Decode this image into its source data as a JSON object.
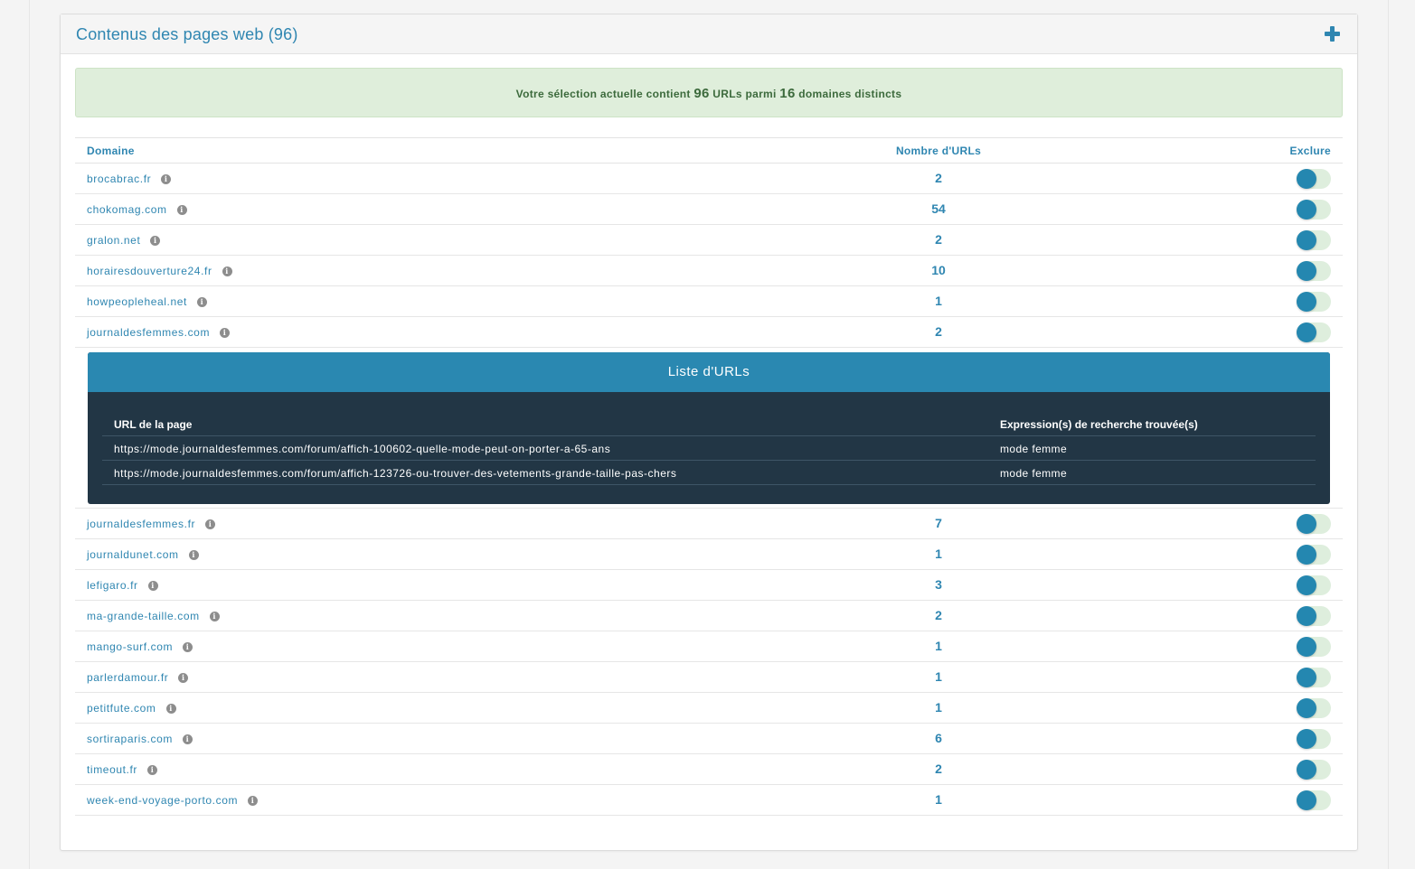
{
  "panel": {
    "title": "Contenus des pages web (96)"
  },
  "alert": {
    "prefix": "Votre sélection actuelle contient",
    "url_count": "96",
    "middle": "URLs parmi",
    "domain_count": "16",
    "suffix": "domaines distincts"
  },
  "table": {
    "headers": {
      "domain": "Domaine",
      "count": "Nombre d'URLs",
      "exclude": "Exclure"
    },
    "rows_before": [
      {
        "domain": "brocabrac.fr",
        "count": "2"
      },
      {
        "domain": "chokomag.com",
        "count": "54"
      },
      {
        "domain": "gralon.net",
        "count": "2"
      },
      {
        "domain": "horairesdouverture24.fr",
        "count": "10"
      },
      {
        "domain": "howpeopleheal.net",
        "count": "1"
      },
      {
        "domain": "journaldesfemmes.com",
        "count": "2"
      }
    ],
    "rows_after": [
      {
        "domain": "journaldesfemmes.fr",
        "count": "7"
      },
      {
        "domain": "journaldunet.com",
        "count": "1"
      },
      {
        "domain": "lefigaro.fr",
        "count": "3"
      },
      {
        "domain": "ma-grande-taille.com",
        "count": "2"
      },
      {
        "domain": "mango-surf.com",
        "count": "1"
      },
      {
        "domain": "parlerdamour.fr",
        "count": "1"
      },
      {
        "domain": "petitfute.com",
        "count": "1"
      },
      {
        "domain": "sortiraparis.com",
        "count": "6"
      },
      {
        "domain": "timeout.fr",
        "count": "2"
      },
      {
        "domain": "week-end-voyage-porto.com",
        "count": "1"
      }
    ]
  },
  "url_list": {
    "title": "Liste d'URLs",
    "headers": {
      "page": "URL de la page",
      "expression": "Expression(s) de recherche trouvée(s)"
    },
    "rows": [
      {
        "url": "https://mode.journaldesfemmes.com/forum/affich-100602-quelle-mode-peut-on-porter-a-65-ans",
        "expression": "mode femme"
      },
      {
        "url": "https://mode.journaldesfemmes.com/forum/affich-123726-ou-trouver-des-vetements-grande-taille-pas-chers",
        "expression": "mode femme"
      }
    ]
  },
  "icons": {
    "expand": "plus-icon",
    "info": "info-circle-icon"
  },
  "colors": {
    "accent": "#2f86b1",
    "alert_bg": "#dfeedb",
    "url_box_bg": "#223645",
    "url_box_header": "#2a88b1",
    "toggle_knob": "#2487b0"
  }
}
